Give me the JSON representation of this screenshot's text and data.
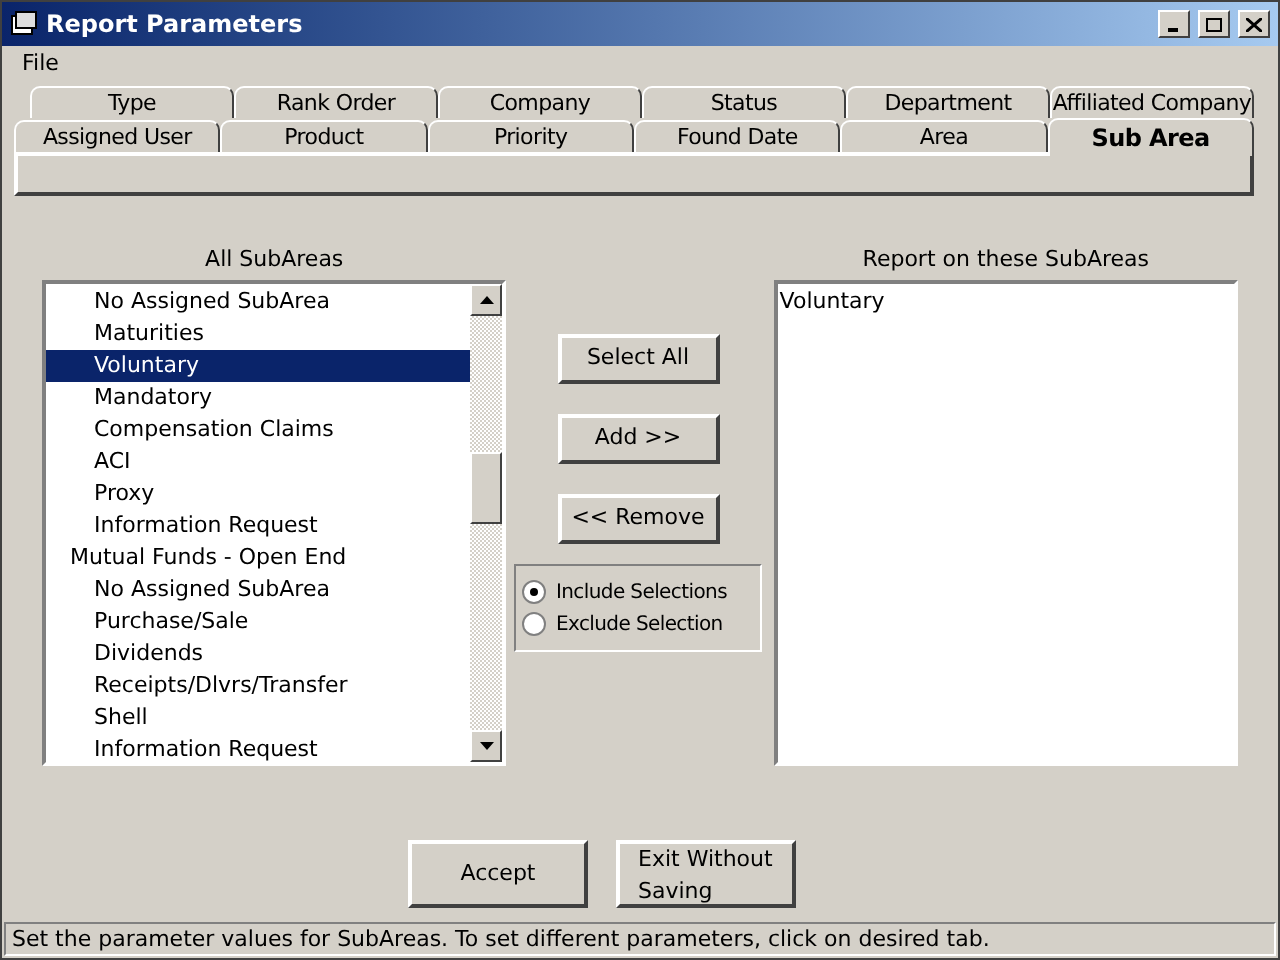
{
  "window": {
    "title": "Report Parameters"
  },
  "menu": [
    "File"
  ],
  "tab_rows": [
    [
      {
        "label": "Type",
        "selected": false
      },
      {
        "label": "Rank Order",
        "selected": false
      },
      {
        "label": "Company",
        "selected": false
      },
      {
        "label": "Status",
        "selected": false
      },
      {
        "label": "Department",
        "selected": false
      },
      {
        "label": "Affiliated Company",
        "selected": false
      }
    ],
    [
      {
        "label": "Assigned User",
        "selected": false
      },
      {
        "label": "Product",
        "selected": false
      },
      {
        "label": "Priority",
        "selected": false
      },
      {
        "label": "Found Date",
        "selected": false
      },
      {
        "label": "Area",
        "selected": false
      },
      {
        "label": "Sub Area",
        "selected": true
      }
    ]
  ],
  "all_list": {
    "heading": "All SubAreas",
    "items": [
      {
        "children": [
          {
            "label": "No Assigned SubArea",
            "selected": false
          },
          {
            "label": "Maturities",
            "selected": false
          },
          {
            "label": "Voluntary",
            "selected": true
          },
          {
            "label": "Mandatory",
            "selected": false
          },
          {
            "label": "Compensation Claims",
            "selected": false
          },
          {
            "label": "ACI",
            "selected": false
          },
          {
            "label": "Proxy",
            "selected": false
          },
          {
            "label": "Information Request",
            "selected": false
          }
        ]
      },
      {
        "label": "Mutual Funds - Open End",
        "selected": false,
        "children": [
          {
            "label": "No Assigned SubArea",
            "selected": false
          },
          {
            "label": "Purchase/Sale",
            "selected": false
          },
          {
            "label": "Dividends",
            "selected": false
          },
          {
            "label": "Receipts/Dlvrs/Transfer",
            "selected": false
          },
          {
            "label": "Shell",
            "selected": false
          },
          {
            "label": "Information Request",
            "selected": false
          }
        ]
      }
    ]
  },
  "buttons": [
    "Select All",
    "Add >>",
    "<< Remove"
  ],
  "options": [
    {
      "label": "Include Selections",
      "selected": true
    },
    {
      "label": "Exclude Selection",
      "selected": false
    }
  ],
  "report_list": {
    "heading": "Report on these SubAreas",
    "items": [
      "Voluntary"
    ]
  },
  "footer_buttons": [
    "Accept",
    "Exit Without Saving"
  ],
  "status_bar": "Set the parameter values for SubAreas.  To set different parameters, click on desired tab."
}
